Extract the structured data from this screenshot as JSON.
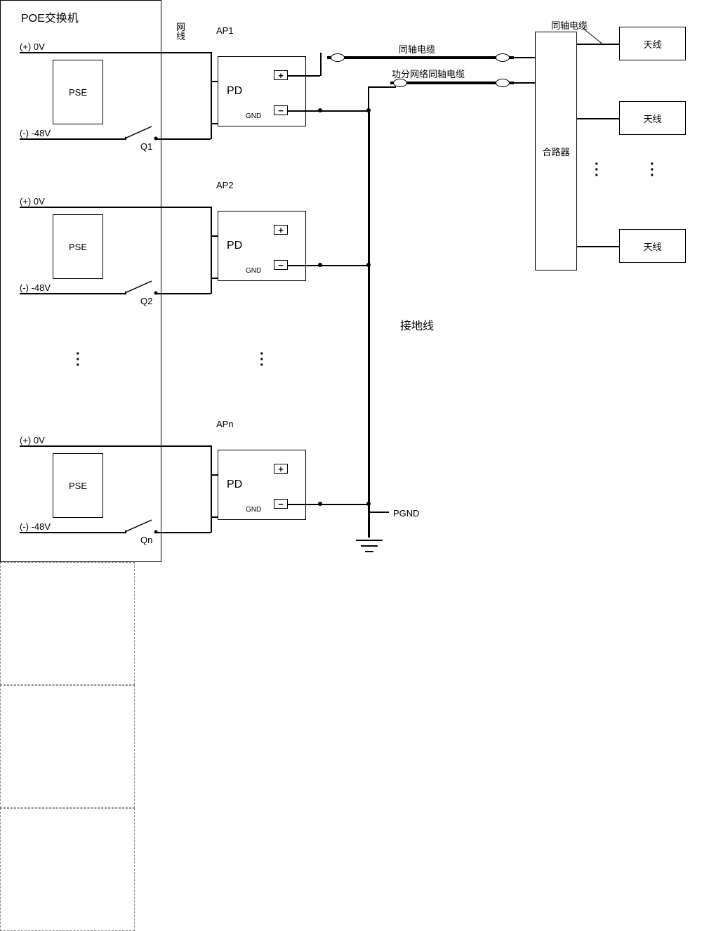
{
  "title": "POE交换机",
  "voltage": {
    "pos": "(+) 0V",
    "neg": "(-) -48V"
  },
  "pse_label": "PSE",
  "pd_label": "PD",
  "gnd_label": "GND",
  "aps": [
    {
      "name": "AP1",
      "switch": "Q1"
    },
    {
      "name": "AP2",
      "switch": "Q2"
    },
    {
      "name": "APn",
      "switch": "Qn"
    }
  ],
  "cable_label": "网线",
  "coax_label": "同轴电缆",
  "power_split_label": "功分网络同轴电缆",
  "ground_wire_label": "接地线",
  "pgnd_label": "PGND",
  "combiner_label": "合路器",
  "antenna_label": "天线",
  "coax_top_label": "同轴电缆"
}
